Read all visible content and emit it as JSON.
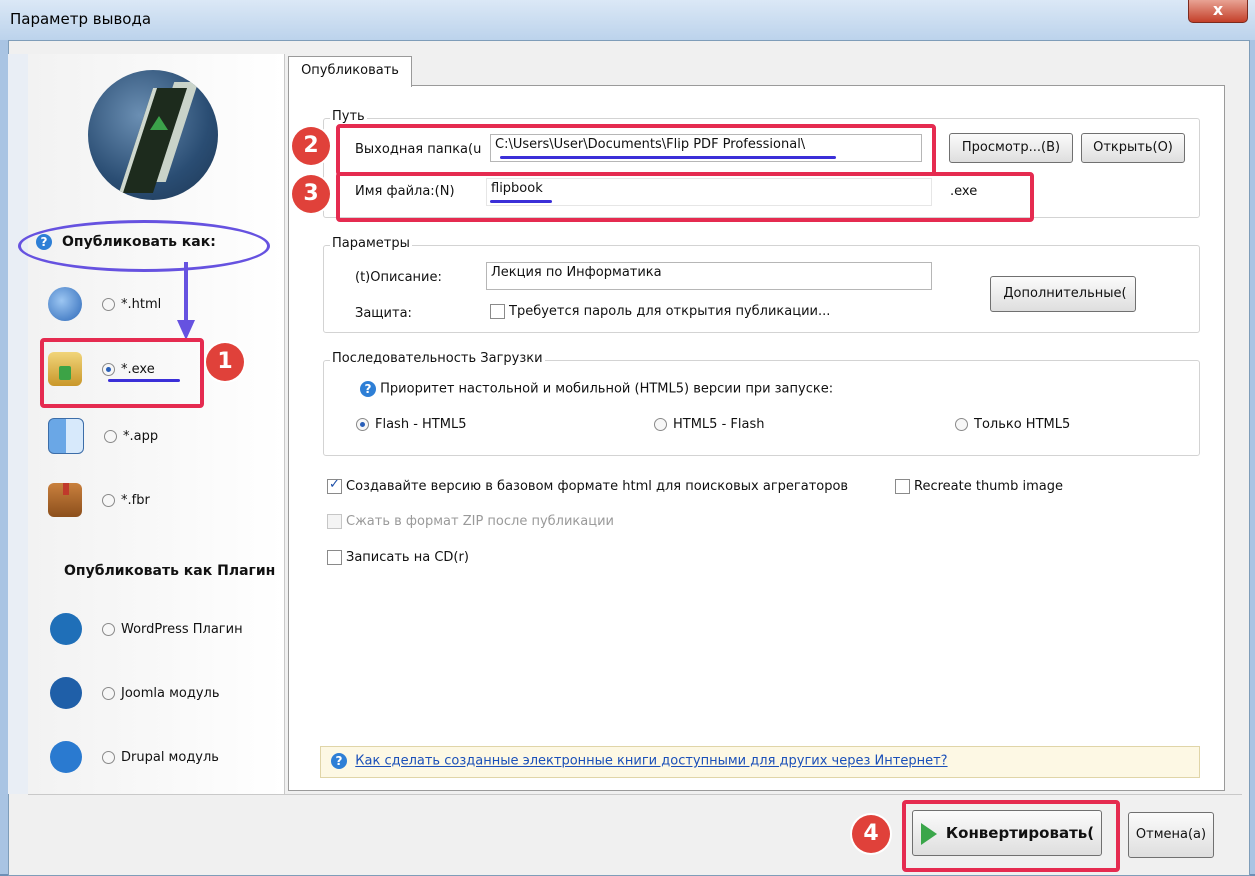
{
  "window": {
    "title": "Параметр вывода",
    "close_symbol": "x"
  },
  "sidebar": {
    "publish_as_label": "Опубликовать как:",
    "formats": [
      {
        "icon": "globe-icon",
        "label": "*.html",
        "selected": false
      },
      {
        "icon": "exe-installer-icon",
        "label": "*.exe",
        "selected": true
      },
      {
        "icon": "mac-finder-icon",
        "label": "*.app",
        "selected": false
      },
      {
        "icon": "book-icon",
        "label": "*.fbr",
        "selected": false
      }
    ],
    "plugins_title": "Опубликовать как Плагин",
    "plugins": [
      {
        "icon": "wordpress-icon",
        "label": "WordPress Плагин",
        "selected": false
      },
      {
        "icon": "joomla-icon",
        "label": "Joomla модуль",
        "selected": false
      },
      {
        "icon": "drupal-icon",
        "label": "Drupal модуль",
        "selected": false
      }
    ]
  },
  "tab": {
    "label": "Опубликовать"
  },
  "path_group": {
    "legend": "Путь",
    "output_folder_label": "Выходная папка(u",
    "output_folder_value": "C:\\Users\\User\\Documents\\Flip PDF Professional\\",
    "browse_button": "Просмотр...(B)",
    "open_button": "Открыть(O)",
    "file_name_label": "Имя файла:(N)",
    "file_name_value": "flipbook",
    "extension": ".exe"
  },
  "params_group": {
    "legend": "Параметры",
    "description_label": "(t)Описание:",
    "description_value": "Лекция по Информатика",
    "protection_label": "Защита:",
    "password_checkbox": "Требуется пароль для открытия публикации...",
    "advanced_button": "Дополнительные("
  },
  "load_group": {
    "legend": "Последовательность Загрузки",
    "priority_text": "Приоритет настольной и мобильной (HTML5) версии при запуске:",
    "options": [
      {
        "label": "Flash - HTML5",
        "selected": true
      },
      {
        "label": "HTML5 - Flash",
        "selected": false
      },
      {
        "label": "Только HTML5",
        "selected": false
      }
    ]
  },
  "checks": {
    "basic_html": {
      "label": "Создавайте версию в базовом формате html для поисковых агрегаторов",
      "checked": true
    },
    "recreate_thumb": {
      "label": "Recreate thumb image",
      "checked": false
    },
    "zip": {
      "label": "Сжать в формат ZIP после публикации",
      "checked": false,
      "disabled": true
    },
    "cd": {
      "label": "Записать на CD(r)",
      "checked": false
    }
  },
  "info_link": "Как сделать созданные электронные книги доступными для других через Интернет?",
  "footer": {
    "convert_button": "Конвертировать(",
    "cancel_button": "Отмена(a)"
  },
  "annotations": {
    "badge_1": "1",
    "badge_2": "2",
    "badge_3": "3",
    "badge_4": "4"
  },
  "colors": {
    "highlight_red": "#e52b50",
    "highlight_blue": "#6652e0",
    "badge_red": "#e0413a"
  }
}
